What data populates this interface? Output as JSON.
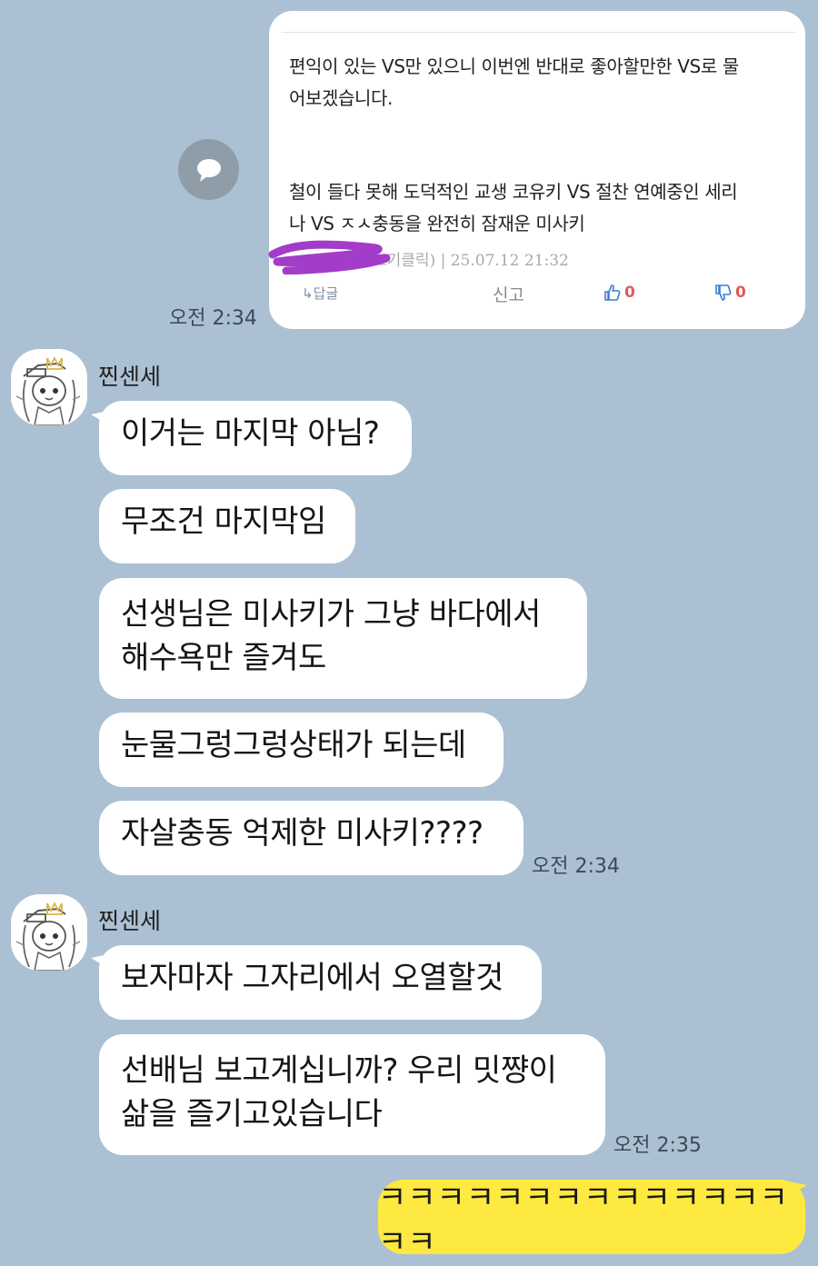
{
  "post": {
    "text_block_1_line_1": "편익이 있는 VS만 있으니 이번엔 반대로 좋아할만한 VS로 물",
    "text_block_1_line_2": "어보겠습니다.",
    "text_block_2_line_1": "철이 들다 못해 도덕적인 교생 코유키 VS 절찬 연예중인 세리",
    "text_block_2_line_2": "나 VS ㅈㅅ충동을 완전히 잠재운 미사키",
    "meta": "보기클릭) | 25.07.12 21:32",
    "reply_label": "↳답글",
    "report_label": "신고",
    "likes": "0",
    "dislikes": "0",
    "time": "오전 2:34"
  },
  "messages": {
    "group1": {
      "sender": "찐센세",
      "bubbles": [
        "이거는 마지막 아님?",
        "무조건 마지막임",
        "선생님은 미사키가 그냥 바다에서",
        "해수욕만 즐겨도",
        "눈물그렁그렁상태가 되는데",
        "자살충동 억제한 미사키????"
      ],
      "time": "오전 2:34"
    },
    "group2": {
      "sender": "찐센세",
      "bubbles": [
        "보자마자 그자리에서 오열할것",
        "선배님 보고계십니까? 우리 밋쨩이",
        "삶을 즐기고있습니다"
      ],
      "time": "오전 2:35"
    },
    "mine": {
      "text": "ㅋㅋㅋㅋㅋㅋㅋㅋㅋㅋㅋㅋㅋㅋㅋㅋ"
    }
  },
  "colors": {
    "background": "#abc0d3",
    "my_bubble": "#fde940",
    "other_bubble": "#ffffff",
    "like_count": "#e05a5a"
  },
  "icons": {
    "share": "speech-bubble-icon",
    "like": "thumbs-up-icon",
    "dislike": "thumbs-down-icon"
  }
}
